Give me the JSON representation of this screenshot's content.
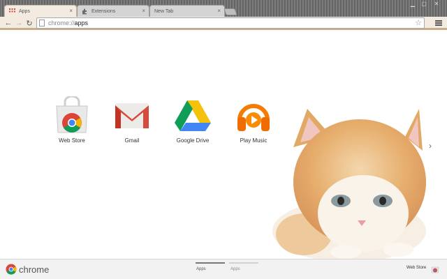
{
  "tabs": [
    {
      "label": "Apps",
      "active": true,
      "icon": "apps-grid-icon"
    },
    {
      "label": "Extensions",
      "active": false,
      "icon": "puzzle-icon"
    },
    {
      "label": "New Tab",
      "active": false,
      "icon": ""
    }
  ],
  "address_bar": {
    "scheme": "chrome://",
    "host": "apps"
  },
  "apps": [
    {
      "label": "Web Store",
      "icon": "web-store-icon"
    },
    {
      "label": "Gmail",
      "icon": "gmail-icon"
    },
    {
      "label": "Google Drive",
      "icon": "google-drive-icon"
    },
    {
      "label": "Play Music",
      "icon": "play-music-icon"
    }
  ],
  "bottom_bar": {
    "brand": "chrome",
    "pages": [
      "Apps",
      "Apps"
    ],
    "web_store_link": "Web Store"
  },
  "colors": {
    "tab_active": "#f3ebe0",
    "toolbar_border": "#c9ad8a",
    "progress_active": "#777777"
  }
}
